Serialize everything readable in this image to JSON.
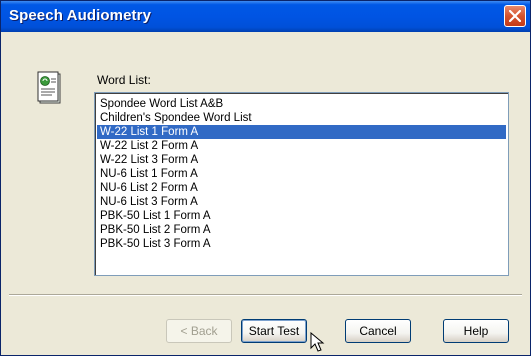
{
  "window": {
    "title": "Speech Audiometry"
  },
  "word_list": {
    "label": "Word List:",
    "items": [
      "Spondee Word List A&B",
      "Children's Spondee Word List",
      "W-22 List 1 Form A",
      "W-22 List 2 Form A",
      "W-22 List 3 Form A",
      "NU-6 List 1 Form A",
      "NU-6 List 2 Form A",
      "NU-6 List 3 Form A",
      "PBK-50 List 1 Form A",
      "PBK-50 List 2 Form A",
      "PBK-50 List 3 Form A"
    ],
    "selected": "W-22 List 1 Form A"
  },
  "buttons": {
    "back": "< Back",
    "start_test": "Start Test",
    "cancel": "Cancel",
    "help": "Help"
  },
  "colors": {
    "title_bar": "#0054e3",
    "selection": "#316ac5",
    "close_button": "#d5532e"
  }
}
